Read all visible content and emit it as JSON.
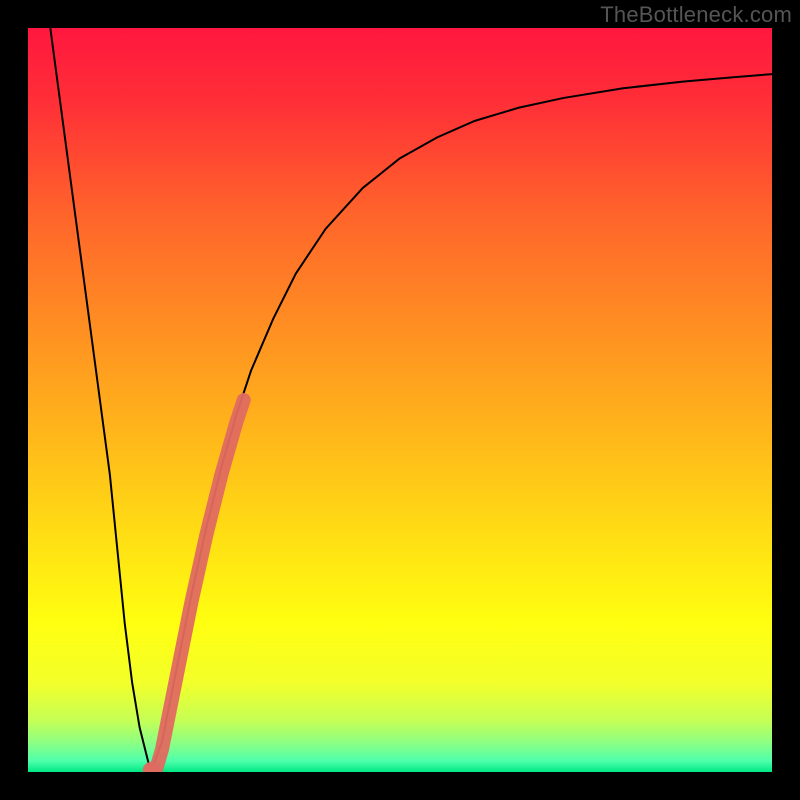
{
  "watermark": "TheBottleneck.com",
  "chart_data": {
    "type": "line",
    "title": "",
    "xlabel": "",
    "ylabel": "",
    "xlim": [
      0,
      100
    ],
    "ylim": [
      0,
      100
    ],
    "grid": false,
    "legend": false,
    "background": {
      "type": "vertical-gradient",
      "stops": [
        {
          "offset": 0.0,
          "color": "#ff173f"
        },
        {
          "offset": 0.1,
          "color": "#ff2f37"
        },
        {
          "offset": 0.25,
          "color": "#ff642b"
        },
        {
          "offset": 0.4,
          "color": "#ff8e22"
        },
        {
          "offset": 0.55,
          "color": "#ffb81a"
        },
        {
          "offset": 0.7,
          "color": "#ffe313"
        },
        {
          "offset": 0.8,
          "color": "#ffff10"
        },
        {
          "offset": 0.88,
          "color": "#f3ff2a"
        },
        {
          "offset": 0.93,
          "color": "#c6ff54"
        },
        {
          "offset": 0.96,
          "color": "#8eff82"
        },
        {
          "offset": 0.985,
          "color": "#4fffab"
        },
        {
          "offset": 1.0,
          "color": "#00e884"
        }
      ]
    },
    "series": [
      {
        "name": "bottleneck-curve",
        "color": "#000000",
        "stroke_width": 2,
        "x": [
          3,
          5,
          7,
          9,
          11,
          12,
          13,
          14,
          15,
          16.5,
          18,
          20,
          22,
          24,
          26,
          28,
          30,
          33,
          36,
          40,
          45,
          50,
          55,
          60,
          66,
          72,
          80,
          88,
          95,
          100
        ],
        "y": [
          100,
          85,
          70,
          55,
          40,
          30,
          20,
          12,
          6,
          0,
          4,
          14,
          24,
          33,
          41,
          48,
          54,
          61,
          67,
          73,
          78.5,
          82.5,
          85.3,
          87.5,
          89.3,
          90.6,
          91.9,
          92.8,
          93.4,
          93.8
        ]
      },
      {
        "name": "highlight-segment",
        "color": "#e06a60",
        "stroke_width": 14,
        "linecap": "round",
        "x": [
          16.5,
          17.2,
          18.0,
          20.0,
          22.0,
          24.0,
          26.0,
          28.0,
          29.0
        ],
        "y": [
          0.0,
          0.3,
          3.0,
          13.0,
          23.0,
          32.0,
          40.0,
          47.0,
          50.0
        ]
      }
    ]
  }
}
